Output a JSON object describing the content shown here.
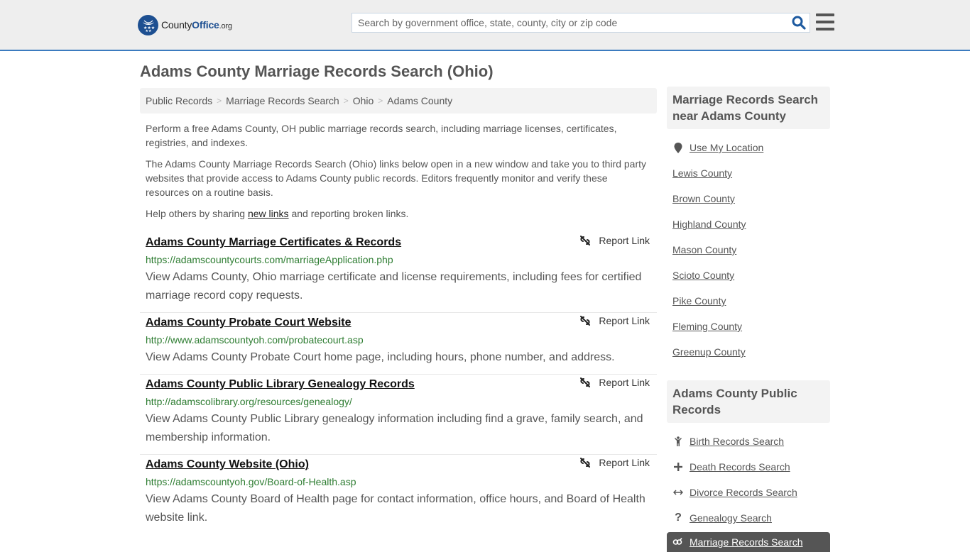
{
  "header": {
    "logo": {
      "prefix": "County",
      "highlight": "Office",
      "suffix": ".org",
      "icon": "eagle-stars-icon"
    },
    "search": {
      "placeholder": "Search by government office, state, county, city or zip code",
      "value": "",
      "icon": "search-icon"
    },
    "menu_icon": "hamburger-menu-icon"
  },
  "page_title": "Adams County Marriage Records Search (Ohio)",
  "breadcrumb": [
    {
      "label": "Public Records"
    },
    {
      "label": "Marriage Records Search"
    },
    {
      "label": "Ohio"
    },
    {
      "label": "Adams County"
    }
  ],
  "breadcrumb_separator": ">",
  "intro": {
    "p1": "Perform a free Adams County, OH public marriage records search, including marriage licenses, certificates, registries, and indexes.",
    "p2": "The Adams County Marriage Records Search (Ohio) links below open in a new window and take you to third party websites that provide access to Adams County public records. Editors frequently monitor and verify these resources on a routine basis.",
    "p3_before": "Help others by sharing ",
    "p3_link": "new links",
    "p3_after": " and reporting broken links."
  },
  "report_label": "Report Link",
  "results": [
    {
      "title": "Adams County Marriage Certificates & Records",
      "url": "https://adamscountycourts.com/marriageApplication.php",
      "description": "View Adams County, Ohio marriage certificate and license requirements, including fees for certified marriage record copy requests."
    },
    {
      "title": "Adams County Probate Court Website",
      "url": "http://www.adamscountyoh.com/probatecourt.asp",
      "description": "View Adams County Probate Court home page, including hours, phone number, and address."
    },
    {
      "title": "Adams County Public Library Genealogy Records",
      "url": "http://adamscolibrary.org/resources/genealogy/",
      "description": "View Adams County Public Library genealogy information including find a grave, family search, and membership information."
    },
    {
      "title": "Adams County Website (Ohio)",
      "url": "https://adamscountyoh.gov/Board-of-Health.asp",
      "description": "View Adams County Board of Health page for contact information, office hours, and Board of Health website link."
    }
  ],
  "sidebar": {
    "nearby": {
      "heading": "Marriage Records Search near Adams County",
      "location_link": "Use My Location",
      "counties": [
        "Lewis County",
        "Brown County",
        "Highland County",
        "Mason County",
        "Scioto County",
        "Pike County",
        "Fleming County",
        "Greenup County"
      ]
    },
    "public_records": {
      "heading": "Adams County Public Records",
      "items": [
        {
          "label": "Birth Records Search",
          "icon": "person-icon"
        },
        {
          "label": "Death Records Search",
          "icon": "cross-icon"
        },
        {
          "label": "Divorce Records Search",
          "icon": "arrows-horizontal-icon"
        },
        {
          "label": "Genealogy Search",
          "icon": "question-icon"
        }
      ],
      "active": {
        "label": "Marriage Records Search",
        "icon": "gender-rings-icon"
      }
    }
  }
}
